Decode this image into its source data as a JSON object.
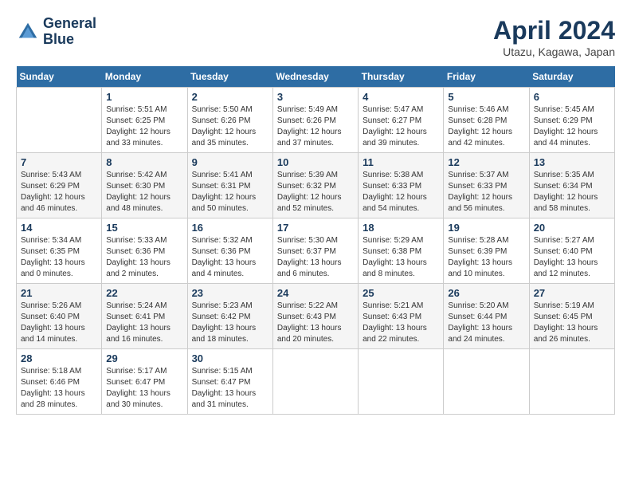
{
  "header": {
    "logo_line1": "General",
    "logo_line2": "Blue",
    "title": "April 2024",
    "subtitle": "Utazu, Kagawa, Japan"
  },
  "weekdays": [
    "Sunday",
    "Monday",
    "Tuesday",
    "Wednesday",
    "Thursday",
    "Friday",
    "Saturday"
  ],
  "weeks": [
    [
      {
        "day": "",
        "sunrise": "",
        "sunset": "",
        "daylight": ""
      },
      {
        "day": "1",
        "sunrise": "Sunrise: 5:51 AM",
        "sunset": "Sunset: 6:25 PM",
        "daylight": "Daylight: 12 hours and 33 minutes."
      },
      {
        "day": "2",
        "sunrise": "Sunrise: 5:50 AM",
        "sunset": "Sunset: 6:26 PM",
        "daylight": "Daylight: 12 hours and 35 minutes."
      },
      {
        "day": "3",
        "sunrise": "Sunrise: 5:49 AM",
        "sunset": "Sunset: 6:26 PM",
        "daylight": "Daylight: 12 hours and 37 minutes."
      },
      {
        "day": "4",
        "sunrise": "Sunrise: 5:47 AM",
        "sunset": "Sunset: 6:27 PM",
        "daylight": "Daylight: 12 hours and 39 minutes."
      },
      {
        "day": "5",
        "sunrise": "Sunrise: 5:46 AM",
        "sunset": "Sunset: 6:28 PM",
        "daylight": "Daylight: 12 hours and 42 minutes."
      },
      {
        "day": "6",
        "sunrise": "Sunrise: 5:45 AM",
        "sunset": "Sunset: 6:29 PM",
        "daylight": "Daylight: 12 hours and 44 minutes."
      }
    ],
    [
      {
        "day": "7",
        "sunrise": "Sunrise: 5:43 AM",
        "sunset": "Sunset: 6:29 PM",
        "daylight": "Daylight: 12 hours and 46 minutes."
      },
      {
        "day": "8",
        "sunrise": "Sunrise: 5:42 AM",
        "sunset": "Sunset: 6:30 PM",
        "daylight": "Daylight: 12 hours and 48 minutes."
      },
      {
        "day": "9",
        "sunrise": "Sunrise: 5:41 AM",
        "sunset": "Sunset: 6:31 PM",
        "daylight": "Daylight: 12 hours and 50 minutes."
      },
      {
        "day": "10",
        "sunrise": "Sunrise: 5:39 AM",
        "sunset": "Sunset: 6:32 PM",
        "daylight": "Daylight: 12 hours and 52 minutes."
      },
      {
        "day": "11",
        "sunrise": "Sunrise: 5:38 AM",
        "sunset": "Sunset: 6:33 PM",
        "daylight": "Daylight: 12 hours and 54 minutes."
      },
      {
        "day": "12",
        "sunrise": "Sunrise: 5:37 AM",
        "sunset": "Sunset: 6:33 PM",
        "daylight": "Daylight: 12 hours and 56 minutes."
      },
      {
        "day": "13",
        "sunrise": "Sunrise: 5:35 AM",
        "sunset": "Sunset: 6:34 PM",
        "daylight": "Daylight: 12 hours and 58 minutes."
      }
    ],
    [
      {
        "day": "14",
        "sunrise": "Sunrise: 5:34 AM",
        "sunset": "Sunset: 6:35 PM",
        "daylight": "Daylight: 13 hours and 0 minutes."
      },
      {
        "day": "15",
        "sunrise": "Sunrise: 5:33 AM",
        "sunset": "Sunset: 6:36 PM",
        "daylight": "Daylight: 13 hours and 2 minutes."
      },
      {
        "day": "16",
        "sunrise": "Sunrise: 5:32 AM",
        "sunset": "Sunset: 6:36 PM",
        "daylight": "Daylight: 13 hours and 4 minutes."
      },
      {
        "day": "17",
        "sunrise": "Sunrise: 5:30 AM",
        "sunset": "Sunset: 6:37 PM",
        "daylight": "Daylight: 13 hours and 6 minutes."
      },
      {
        "day": "18",
        "sunrise": "Sunrise: 5:29 AM",
        "sunset": "Sunset: 6:38 PM",
        "daylight": "Daylight: 13 hours and 8 minutes."
      },
      {
        "day": "19",
        "sunrise": "Sunrise: 5:28 AM",
        "sunset": "Sunset: 6:39 PM",
        "daylight": "Daylight: 13 hours and 10 minutes."
      },
      {
        "day": "20",
        "sunrise": "Sunrise: 5:27 AM",
        "sunset": "Sunset: 6:40 PM",
        "daylight": "Daylight: 13 hours and 12 minutes."
      }
    ],
    [
      {
        "day": "21",
        "sunrise": "Sunrise: 5:26 AM",
        "sunset": "Sunset: 6:40 PM",
        "daylight": "Daylight: 13 hours and 14 minutes."
      },
      {
        "day": "22",
        "sunrise": "Sunrise: 5:24 AM",
        "sunset": "Sunset: 6:41 PM",
        "daylight": "Daylight: 13 hours and 16 minutes."
      },
      {
        "day": "23",
        "sunrise": "Sunrise: 5:23 AM",
        "sunset": "Sunset: 6:42 PM",
        "daylight": "Daylight: 13 hours and 18 minutes."
      },
      {
        "day": "24",
        "sunrise": "Sunrise: 5:22 AM",
        "sunset": "Sunset: 6:43 PM",
        "daylight": "Daylight: 13 hours and 20 minutes."
      },
      {
        "day": "25",
        "sunrise": "Sunrise: 5:21 AM",
        "sunset": "Sunset: 6:43 PM",
        "daylight": "Daylight: 13 hours and 22 minutes."
      },
      {
        "day": "26",
        "sunrise": "Sunrise: 5:20 AM",
        "sunset": "Sunset: 6:44 PM",
        "daylight": "Daylight: 13 hours and 24 minutes."
      },
      {
        "day": "27",
        "sunrise": "Sunrise: 5:19 AM",
        "sunset": "Sunset: 6:45 PM",
        "daylight": "Daylight: 13 hours and 26 minutes."
      }
    ],
    [
      {
        "day": "28",
        "sunrise": "Sunrise: 5:18 AM",
        "sunset": "Sunset: 6:46 PM",
        "daylight": "Daylight: 13 hours and 28 minutes."
      },
      {
        "day": "29",
        "sunrise": "Sunrise: 5:17 AM",
        "sunset": "Sunset: 6:47 PM",
        "daylight": "Daylight: 13 hours and 30 minutes."
      },
      {
        "day": "30",
        "sunrise": "Sunrise: 5:15 AM",
        "sunset": "Sunset: 6:47 PM",
        "daylight": "Daylight: 13 hours and 31 minutes."
      },
      {
        "day": "",
        "sunrise": "",
        "sunset": "",
        "daylight": ""
      },
      {
        "day": "",
        "sunrise": "",
        "sunset": "",
        "daylight": ""
      },
      {
        "day": "",
        "sunrise": "",
        "sunset": "",
        "daylight": ""
      },
      {
        "day": "",
        "sunrise": "",
        "sunset": "",
        "daylight": ""
      }
    ]
  ]
}
